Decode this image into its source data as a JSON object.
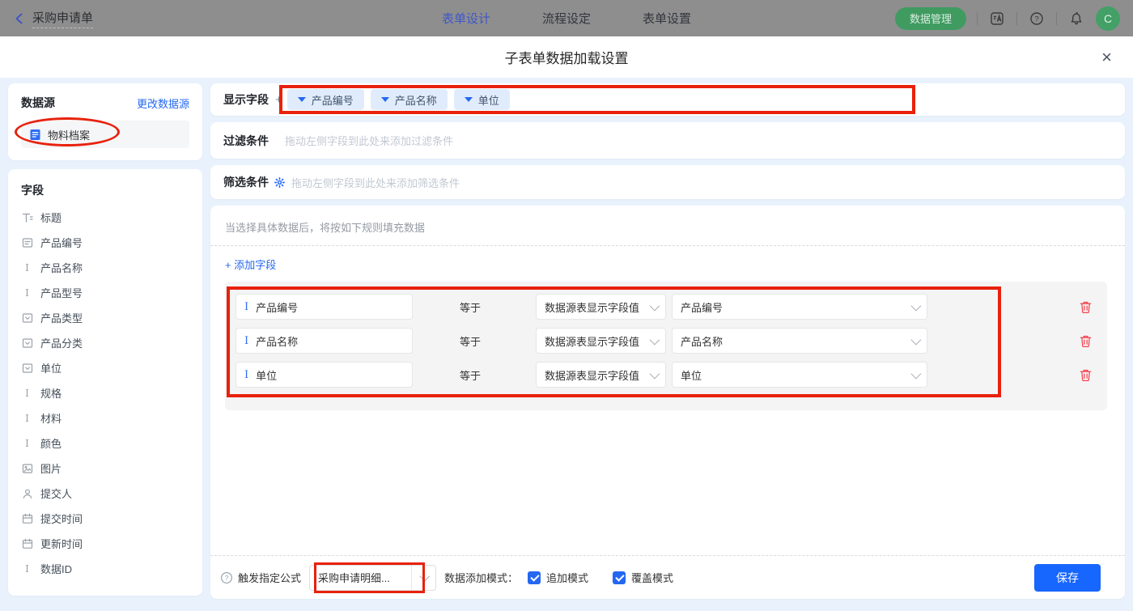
{
  "topbar": {
    "back_label": "采购申请单",
    "tabs": [
      {
        "label": "表单设计",
        "active": true
      },
      {
        "label": "流程设定",
        "active": false
      },
      {
        "label": "表单设置",
        "active": false
      }
    ],
    "data_manage_label": "数据管理",
    "avatar_letter": "C"
  },
  "dialog": {
    "title": "子表单数据加载设置",
    "close_glyph": "×"
  },
  "sidebar": {
    "datasource_title": "数据源",
    "change_link": "更改数据源",
    "datasource_item": "物料档案",
    "fields_title": "字段",
    "fields": [
      {
        "icon": "title-icon",
        "label": "标题"
      },
      {
        "icon": "serial-icon",
        "label": "产品编号"
      },
      {
        "icon": "text-icon",
        "label": "产品名称"
      },
      {
        "icon": "text-icon",
        "label": "产品型号"
      },
      {
        "icon": "select-icon",
        "label": "产品类型"
      },
      {
        "icon": "select-icon",
        "label": "产品分类"
      },
      {
        "icon": "select-icon",
        "label": "单位"
      },
      {
        "icon": "text-icon",
        "label": "规格"
      },
      {
        "icon": "text-icon",
        "label": "材料"
      },
      {
        "icon": "text-icon",
        "label": "颜色"
      },
      {
        "icon": "image-icon",
        "label": "图片"
      },
      {
        "icon": "user-icon",
        "label": "提交人"
      },
      {
        "icon": "date-icon",
        "label": "提交时间"
      },
      {
        "icon": "date-icon",
        "label": "更新时间"
      },
      {
        "icon": "text-icon",
        "label": "数据ID"
      }
    ]
  },
  "main": {
    "display_fields": {
      "label": "显示字段",
      "add_glyph": "+",
      "tags": [
        "产品编号",
        "产品名称",
        "单位"
      ]
    },
    "filter": {
      "label": "过滤条件",
      "placeholder": "拖动左侧字段到此处来添加过滤条件"
    },
    "screen": {
      "label": "筛选条件",
      "placeholder": "拖动左侧字段到此处来添加筛选条件"
    },
    "rules": {
      "hint": "当选择具体数据后，将按如下规则填充数据",
      "add_field_label": "+ 添加字段",
      "rows": [
        {
          "field": "产品编号",
          "op": "等于",
          "source": "数据源表显示字段值",
          "value": "产品编号"
        },
        {
          "field": "产品名称",
          "op": "等于",
          "source": "数据源表显示字段值",
          "value": "产品名称"
        },
        {
          "field": "单位",
          "op": "等于",
          "source": "数据源表显示字段值",
          "value": "单位"
        }
      ]
    },
    "footer": {
      "formula_label": "触发指定公式",
      "formula_value": "采购申请明细...",
      "mode_label": "数据添加模式：",
      "checkboxes": [
        {
          "label": "追加模式",
          "checked": true
        },
        {
          "label": "覆盖模式",
          "checked": true
        }
      ],
      "save_label": "保存"
    }
  },
  "colors": {
    "primary_blue": "#2468f2",
    "save_blue": "#1766fe",
    "annotation_red": "#e8210c",
    "green_button": "#409b61",
    "danger_red": "#f2434e"
  }
}
